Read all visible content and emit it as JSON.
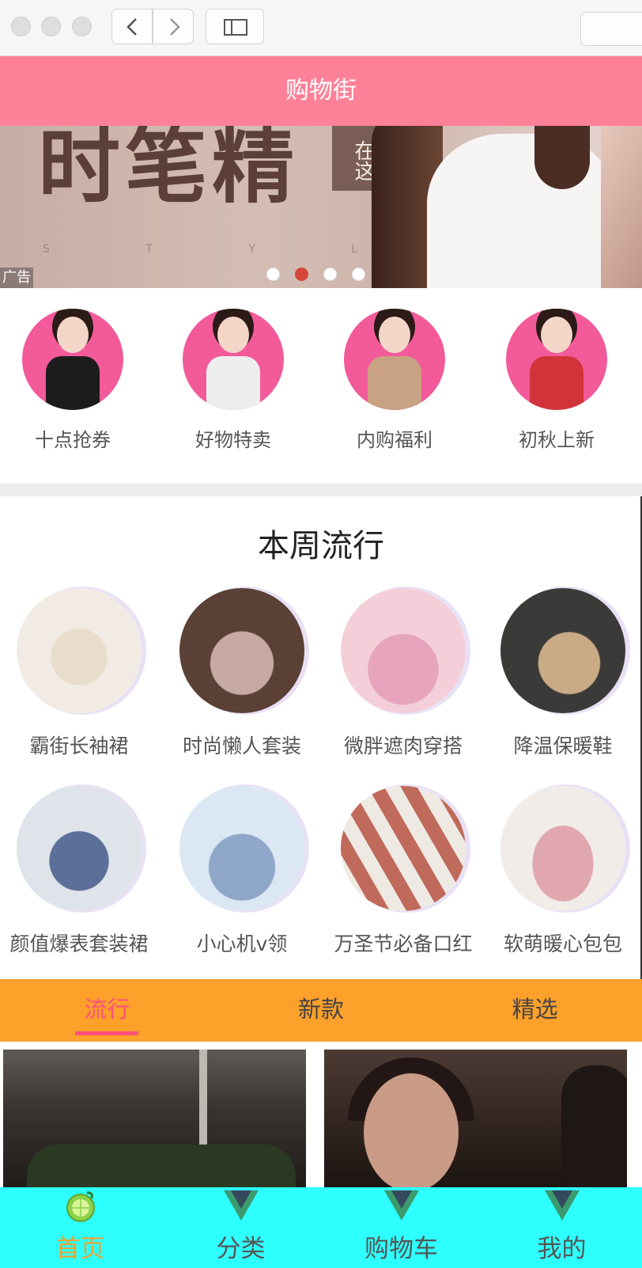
{
  "header": {
    "title": "购物街"
  },
  "banner": {
    "headline": "时笔精",
    "tag": "在这",
    "style_letters": [
      "S",
      "T",
      "Y",
      "L"
    ],
    "ad_label": "广告",
    "dots_total": 4,
    "active_dot": 1
  },
  "recommend": [
    {
      "label": "十点抢券",
      "outfit": "#1c1c1c"
    },
    {
      "label": "好物特卖",
      "outfit": "#eeeeee"
    },
    {
      "label": "内购福利",
      "outfit": "#c9a183"
    },
    {
      "label": "初秋上新",
      "outfit": "#d0343a"
    }
  ],
  "feature": {
    "title": "本周流行",
    "items": [
      {
        "label": "霸街长袖裙",
        "bg": "#f2ebe3",
        "fg": "#e8dccd"
      },
      {
        "label": "时尚懒人套装",
        "bg": "#5a4035",
        "fg": "#c7aba3"
      },
      {
        "label": "微胖遮肉穿搭",
        "bg": "#f4cfd9",
        "fg": "#e6a5bc"
      },
      {
        "label": "降温保暖鞋",
        "bg": "#3a3a38",
        "fg": "#c9ab86"
      },
      {
        "label": "颜值爆表套装裙",
        "bg": "#dfe4ea",
        "fg": "#5b6f99"
      },
      {
        "label": "小心机v领",
        "bg": "#dbe7f2",
        "fg": "#8fa7c9"
      },
      {
        "label": "万圣节必备口红",
        "bg": "#efe9e4",
        "fg": "#c06a5b"
      },
      {
        "label": "软萌暖心包包",
        "bg": "#f1ece8",
        "fg": "#e0a8ae"
      }
    ]
  },
  "tabs": {
    "items": [
      "流行",
      "新款",
      "精选"
    ],
    "active": 0
  },
  "tabbar": {
    "items": [
      {
        "label": "首页",
        "icon": "lime-icon"
      },
      {
        "label": "分类",
        "icon": "vue-icon"
      },
      {
        "label": "购物车",
        "icon": "vue-icon"
      },
      {
        "label": "我的",
        "icon": "vue-icon"
      }
    ],
    "active": 0
  },
  "colors": {
    "header": "#ff8198",
    "tab_control": "#fda12b",
    "tab_active": "#ff4f7a",
    "tabbar": "#2effff",
    "tabbar_active": "#f0a02a"
  }
}
